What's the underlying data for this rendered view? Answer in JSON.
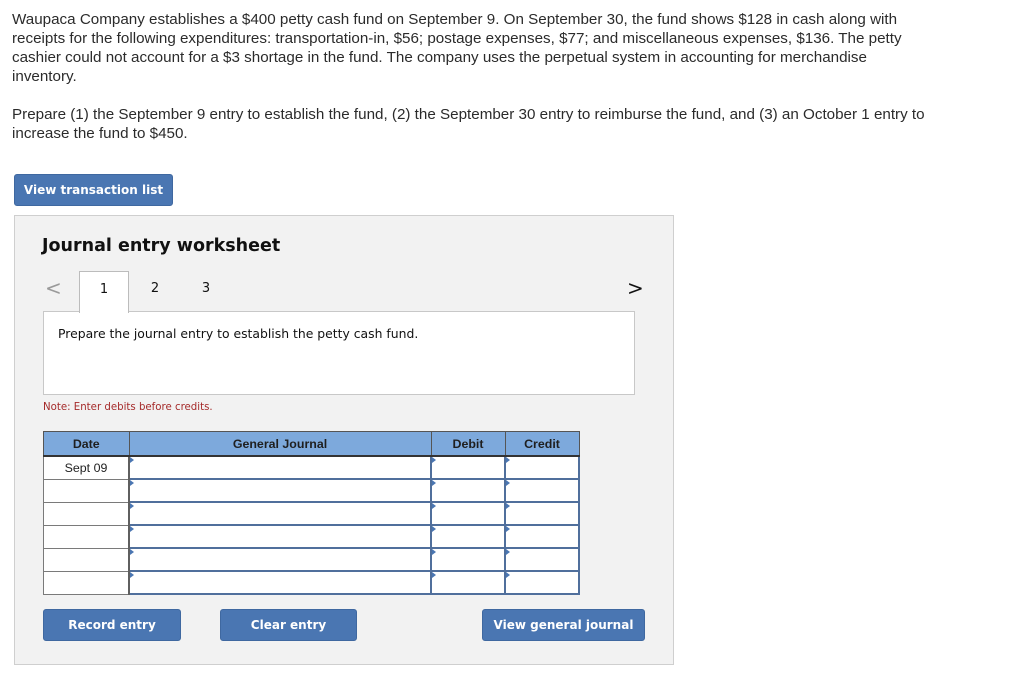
{
  "problem": {
    "paragraph1": "Waupaca Company establishes a $400 petty cash fund on September 9. On September 30, the fund shows $128 in cash along with receipts for the following expenditures: transportation-in, $56; postage expenses, $77; and miscellaneous expenses, $136. The petty cashier could not account for a $3 shortage in the fund. The company uses the perpetual system in accounting for merchandise inventory.",
    "paragraph2": "Prepare (1) the September 9 entry to establish the fund, (2) the September 30 entry to reimburse the fund, and (3) an October 1 entry to increase the fund to $450."
  },
  "buttons": {
    "view_transaction_list": "View transaction list",
    "record_entry": "Record entry",
    "clear_entry": "Clear entry",
    "view_general_journal": "View general journal"
  },
  "worksheet": {
    "title": "Journal entry worksheet",
    "prev_icon": "<",
    "next_icon": ">",
    "tabs": [
      "1",
      "2",
      "3"
    ],
    "active_tab": "1",
    "instruction": "Prepare the journal entry to establish the petty cash fund.",
    "note": "Note: Enter debits before credits."
  },
  "journal": {
    "headers": {
      "date": "Date",
      "account": "General Journal",
      "debit": "Debit",
      "credit": "Credit"
    },
    "rows": [
      {
        "date": "Sept 09",
        "account": "",
        "debit": "",
        "credit": ""
      },
      {
        "date": "",
        "account": "",
        "debit": "",
        "credit": ""
      },
      {
        "date": "",
        "account": "",
        "debit": "",
        "credit": ""
      },
      {
        "date": "",
        "account": "",
        "debit": "",
        "credit": ""
      },
      {
        "date": "",
        "account": "",
        "debit": "",
        "credit": ""
      },
      {
        "date": "",
        "account": "",
        "debit": "",
        "credit": ""
      }
    ]
  },
  "colors": {
    "button": "#4a76b2",
    "header": "#7da9dc",
    "note": "#a52a2a",
    "panel": "#f2f2f2"
  }
}
